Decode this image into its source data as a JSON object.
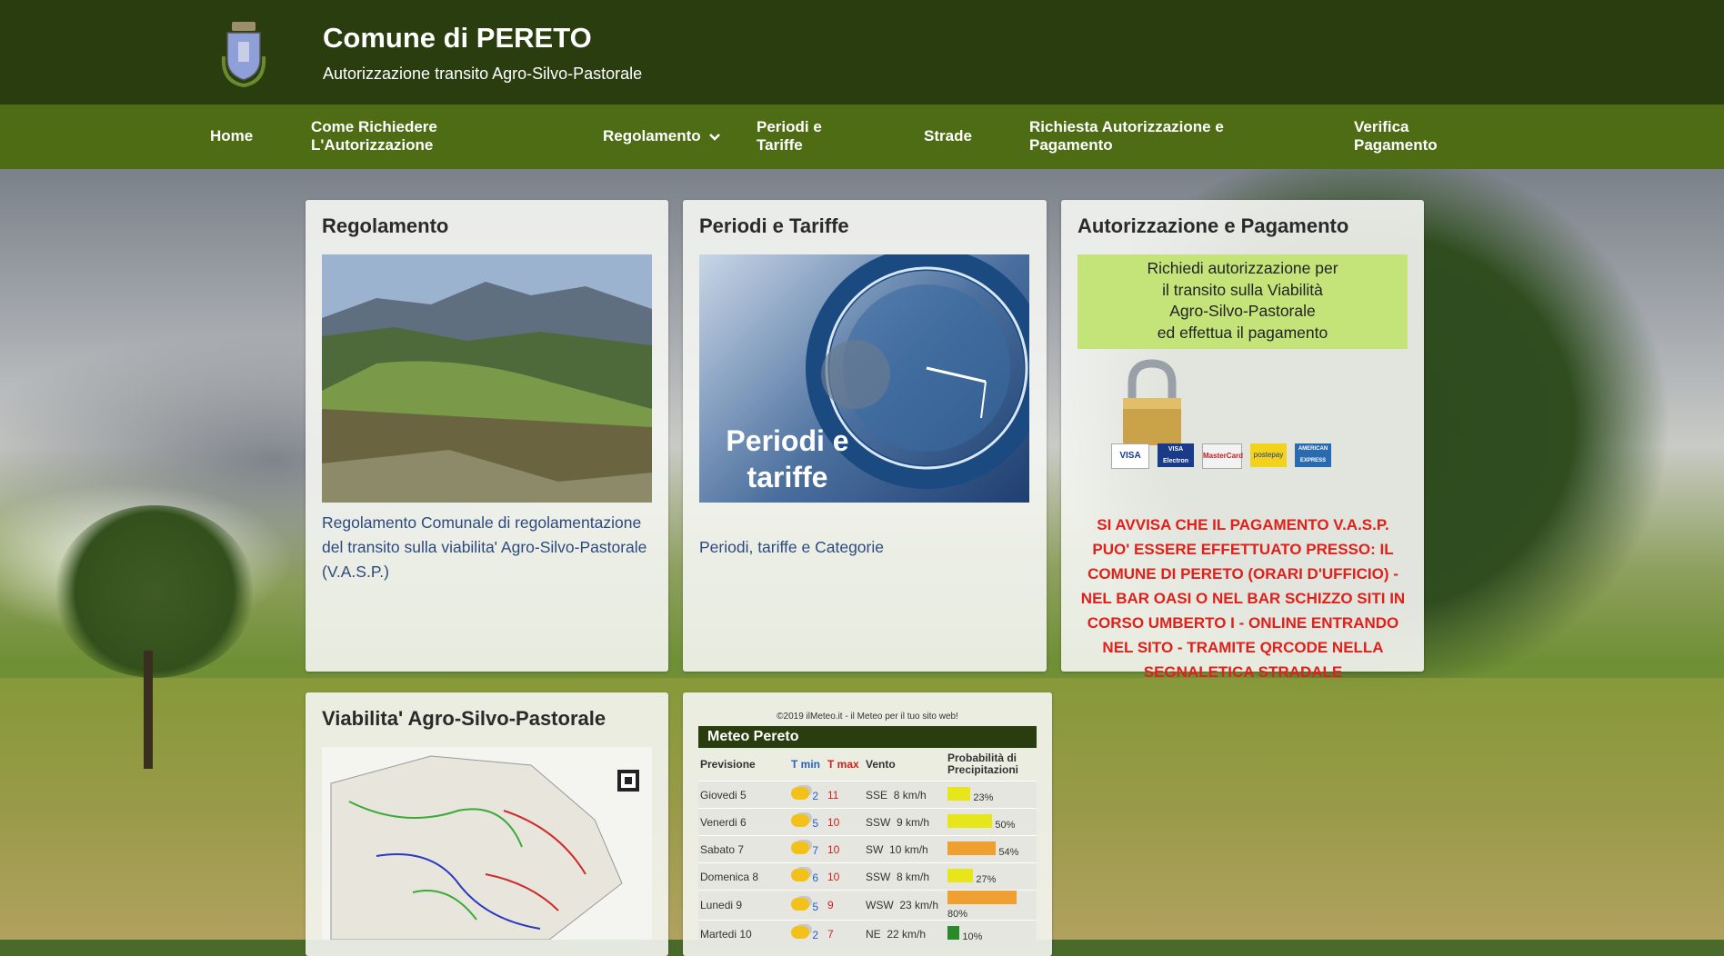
{
  "header": {
    "title": "Comune di PERETO",
    "subtitle": "Autorizzazione transito Agro-Silvo-Pastorale"
  },
  "nav": {
    "home": "Home",
    "come_richiedere": "Come Richiedere L'Autorizzazione",
    "regolamento": "Regolamento",
    "periodi": "Periodi e Tariffe",
    "strade": "Strade",
    "richiesta": "Richiesta Autorizzazione e Pagamento",
    "verifica": "Verifica Pagamento"
  },
  "cards": {
    "regolamento": {
      "title": "Regolamento",
      "link": "Regolamento Comunale di regolamentazione del transito sulla viabilita' Agro-Silvo-Pastorale (V.A.S.P.)"
    },
    "periodi": {
      "title": "Periodi e Tariffe",
      "image_text": "Periodi e tariffe",
      "link": "Periodi, tariffe  e Categorie"
    },
    "autorizzazione": {
      "title": "Autorizzazione e Pagamento",
      "banner_line1": "Richiedi autorizzazione per",
      "banner_line2": "il transito sulla Viabilità",
      "banner_line3": "Agro-Silvo-Pastorale",
      "banner_line4": "ed effettua il pagamento",
      "cards_icons": [
        "VISA",
        "VISA Electron",
        "MasterCard",
        "postepay",
        "AMERICAN EXPRESS"
      ],
      "notice": "SI AVVISA CHE  IL PAGAMENTO V.A.S.P. PUO' ESSERE EFFETTUATO PRESSO: IL COMUNE DI PERETO (ORARI D'UFFICIO) - NEL BAR OASI O NEL BAR SCHIZZO SITI IN CORSO UMBERTO I - ONLINE ENTRANDO NEL SITO - TRAMITE QRCODE NELLA SEGNALETICA STRADALE"
    },
    "viabilita": {
      "title": "Viabilita' Agro-Silvo-Pastorale"
    }
  },
  "meteo": {
    "credit": "©2019 ilMeteo.it - il Meteo per il tuo sito web!",
    "title": "Meteo Pereto",
    "headers": [
      "Previsione",
      "T min",
      "T max",
      "Vento",
      "Probabilità di Precipitazioni"
    ],
    "rows": [
      {
        "day": "Giovedi 5",
        "tmin": "2",
        "tmax": "11",
        "dir": "SSE",
        "speed": "8 km/h",
        "prob": "23%"
      },
      {
        "day": "Venerdi 6",
        "tmin": "5",
        "tmax": "10",
        "dir": "SSW",
        "speed": "9 km/h",
        "prob": "50%"
      },
      {
        "day": "Sabato 7",
        "tmin": "7",
        "tmax": "10",
        "dir": "SW",
        "speed": "10 km/h",
        "prob": "54%"
      },
      {
        "day": "Domenica 8",
        "tmin": "6",
        "tmax": "10",
        "dir": "SSW",
        "speed": "8 km/h",
        "prob": "27%"
      },
      {
        "day": "Lunedi 9",
        "tmin": "5",
        "tmax": "9",
        "dir": "WSW",
        "speed": "23 km/h",
        "prob": "80%"
      },
      {
        "day": "Martedi 10",
        "tmin": "2",
        "tmax": "7",
        "dir": "NE",
        "speed": "22 km/h",
        "prob": "10%"
      }
    ],
    "prob_values": [
      0.23,
      0.5,
      0.54,
      0.27,
      0.8,
      0.1
    ],
    "colors": {
      "low": "#e6e61a",
      "high": "#f0a030",
      "min": "#2a8a2a"
    }
  }
}
